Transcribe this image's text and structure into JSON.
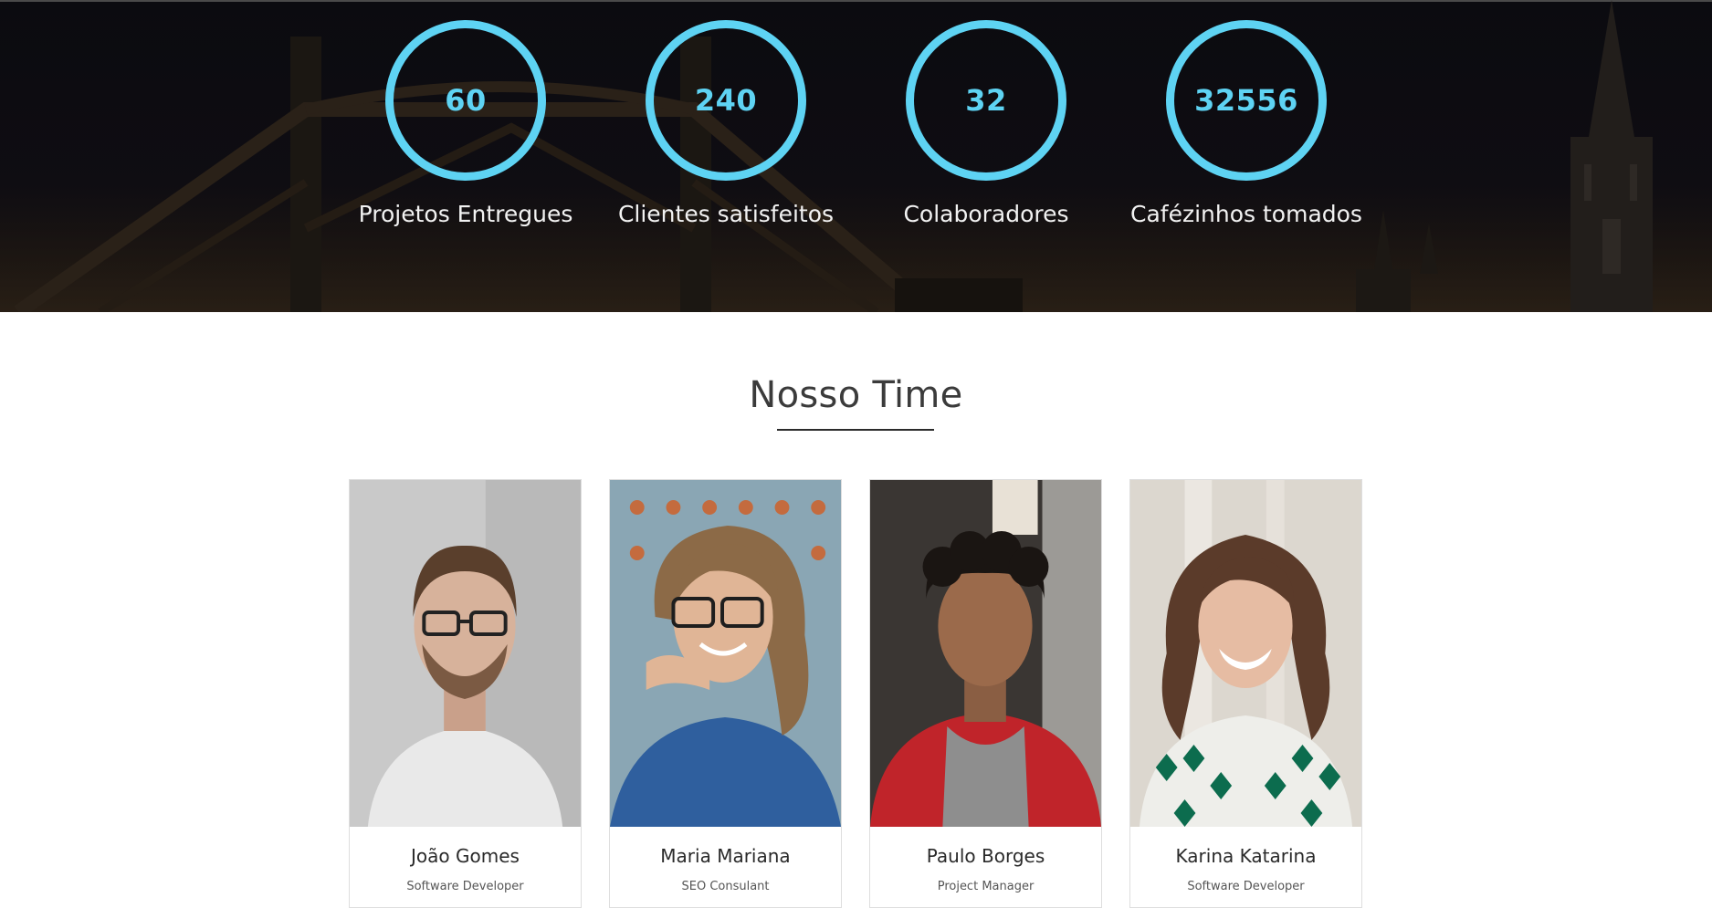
{
  "stats": [
    {
      "value": "60",
      "label": "Projetos Entregues"
    },
    {
      "value": "240",
      "label": "Clientes satisfeitos"
    },
    {
      "value": "32",
      "label": "Colaboradores"
    },
    {
      "value": "32556",
      "label": "Cafézinhos tomados"
    }
  ],
  "team": {
    "title": "Nosso Time",
    "members": [
      {
        "name": "João Gomes",
        "role": "Software Developer"
      },
      {
        "name": "Maria Mariana",
        "role": "SEO Consulant"
      },
      {
        "name": "Paulo Borges",
        "role": "Project Manager"
      },
      {
        "name": "Karina Katarina",
        "role": "Software Developer"
      }
    ]
  },
  "colors": {
    "accent": "#5ed3f3",
    "stats_background": "#0b0b10",
    "heading": "#3b3b3b"
  }
}
